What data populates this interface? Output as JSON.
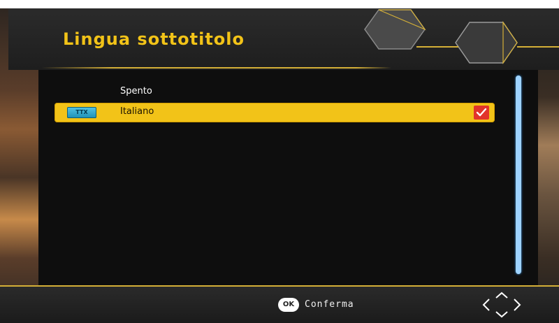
{
  "header": {
    "title": "Lingua sottotitolo"
  },
  "list": {
    "items": [
      {
        "label": "Spento",
        "selected": false,
        "checked": false
      },
      {
        "label": "Italiano",
        "selected": true,
        "checked": true,
        "badge_icon": "teletext-icon",
        "badge_text": "TTX"
      }
    ]
  },
  "footer": {
    "ok_button": "OK",
    "confirm_label": "Conferma",
    "nav_icon": "directional-arrows-icon"
  },
  "colors": {
    "accent": "#f2c318",
    "check": "#e2342b",
    "scrollbar": "#9fd3ff"
  }
}
